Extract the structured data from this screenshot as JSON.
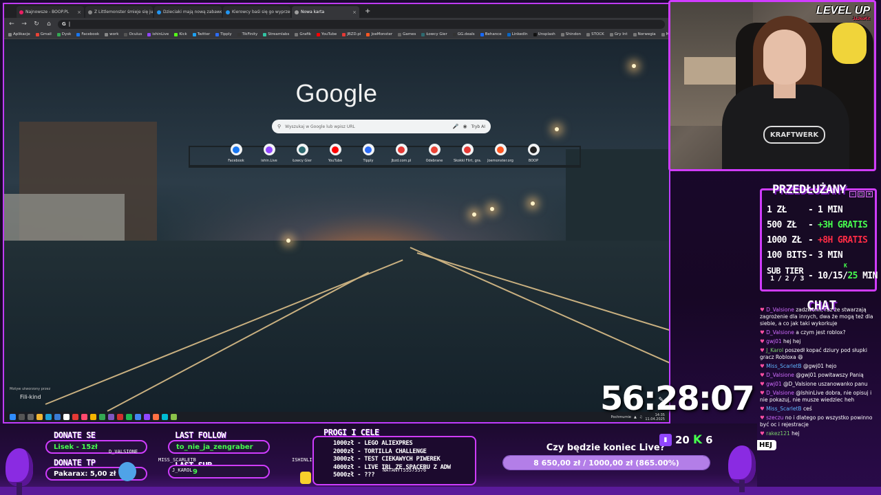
{
  "browser": {
    "tabs": [
      {
        "title": "Najnowsze - BOOP.PL",
        "color": "#e91e63"
      },
      {
        "title": "Z Littlemonster śmieje się już z",
        "color": "#888888"
      },
      {
        "title": "Dzieciaki mają nową zabawę. N",
        "color": "#2196f3"
      },
      {
        "title": "Kierowcy baśi się go wyprzedz",
        "color": "#2196f3"
      },
      {
        "title": "Nowa karta",
        "color": "#9e9e9e"
      }
    ],
    "new_tab_symbol": "+",
    "address_value": "",
    "bookmarks": [
      "Aplikacje",
      "Gmail",
      "Dysk",
      "Facebook",
      "work",
      "Oculus",
      "ishinLive",
      "Kick",
      "Twitter",
      "Tipply",
      "TikFinity",
      "Streamlabs",
      "Grafik",
      "YouTube",
      "JBZD.pl",
      "JoeMonster",
      "Games",
      "Łowcy Gier",
      "GG.deals",
      "Behance",
      "LinkedIn",
      "Unsplash",
      "Shindon",
      "STOCK",
      "Gry Int",
      "Norwegia",
      "Memory 5"
    ],
    "google_logo": "Google",
    "search_placeholder": "Wyszukaj w Google lub wpisz URL",
    "ai_mode": "Tryb AI",
    "shortcuts": [
      {
        "label": "Facebook",
        "color": "#1877f2"
      },
      {
        "label": "ishin.Live",
        "color": "#9146ff"
      },
      {
        "label": "Łowcy Gier",
        "color": "#2d6a70"
      },
      {
        "label": "YouTube",
        "color": "#ff0000"
      },
      {
        "label": "Tipply",
        "color": "#2c6cf6"
      },
      {
        "label": "Jbzd.com.pl",
        "color": "#e53935"
      },
      {
        "label": "Odebrane",
        "color": "#ea4335"
      },
      {
        "label": "Skokki Flirt, gra...",
        "color": "#e53935"
      },
      {
        "label": "Joemonster.org",
        "color": "#ff5722"
      },
      {
        "label": "BOOP",
        "color": "#222222"
      }
    ],
    "credit_small": "Motyw utworzony przez",
    "credit_name": "Fili-kind",
    "tray_label": "Pochmurnie",
    "clock_time": "14:35",
    "clock_date": "11.04.2025"
  },
  "overlay": {
    "levelup": "LEVEL UP",
    "levelup_sub": "JaJkoKit",
    "shirt_text": "KRAFTWERK",
    "panel_title": "PRZEDŁUŻANY",
    "prices": [
      {
        "left": "1 ZŁ",
        "dash": "-",
        "right": "1 MIN",
        "style": ""
      },
      {
        "left": "500 ZŁ",
        "dash": "-",
        "right": "+3H GRATIS",
        "style": "green"
      },
      {
        "left": "1000 ZŁ",
        "dash": "-",
        "right": "+8H GRATIS",
        "style": "red"
      },
      {
        "left": "100 BITS",
        "dash": "-",
        "right": "3 MIN",
        "style": ""
      }
    ],
    "sub_tier_label": "SUB TIER",
    "sub_tier_sub": "1 / 2 / 3",
    "sub_tier_value": "10/15/",
    "sub_tier_value_green": "25",
    "sub_tier_unit": " MIN",
    "sub_tier_k": "K",
    "chat_title": "CHAT",
    "chat_messages": [
      {
        "user": "D_Valsione",
        "text": "zadzwonił, raz że stwarzają zagrożenie dla innych, dwa że mogą też dla siebie, a co jak taki wykorkuje",
        "uclass": "u"
      },
      {
        "user": "D_Valsione",
        "text": "a czym jest roblox?",
        "uclass": "u"
      },
      {
        "user": "gwj01",
        "text": "hej hej",
        "uclass": "u"
      },
      {
        "user": "J_Karol",
        "text": "poszedł kopać dziury pod słupki gracz Robloxa 😄",
        "uclass": "u2"
      },
      {
        "user": "Miss_ScarletB",
        "text": "@gwj01 hejo",
        "uclass": "u3"
      },
      {
        "user": "D_Valsione",
        "text": "@gwj01 powitawszy Panią",
        "uclass": "u"
      },
      {
        "user": "gwj01",
        "text": "@D_Valsione uszanowanko panu",
        "uclass": "u"
      },
      {
        "user": "D_Valsione",
        "text": "@IshinLive dobra, nie opisuj i nie pokazuj, nie musze wiedziec heh",
        "uclass": "u"
      },
      {
        "user": "Miss_ScarletB",
        "text": "ceś",
        "uclass": "u3"
      },
      {
        "user": "szeczu",
        "text": "no i dlatego po wszystko powinno być oc i rejestracje",
        "uclass": "u"
      },
      {
        "user": "rakez121",
        "text": "hej",
        "uclass": "u2"
      }
    ],
    "hej_label": "HEJ",
    "timer": "56:28:07",
    "donate_se_label": "DONATE SE",
    "donate_se_value": "Lisek - 15zł",
    "donate_se_name": "D_VALSIONE",
    "donate_tp_label": "DONATE TP",
    "donate_tp_value": "Pakarax: 5,00 zł",
    "last_follow_label": "LAST FOLLOW",
    "last_follow_value": "to_nie_ja_zengraber",
    "last_sub_label": "LAST SUB",
    "last_sub_name": "MISS_SCARLETB",
    "last_sub_name2": "J_KAROL",
    "last_sub_count": "9",
    "ishin_name": "ISHINLIVE",
    "natan_name": "NATANYT55575576",
    "goals_label": "PROGI I CELE",
    "goals": [
      "1000zł - LEGO ALIEXPRES",
      "2000zł - TORTILLA CHALLENGE",
      "3000zł - TEST CIEKAWYCH PIWEREK",
      "4000zł - LIVE IRL ZE SPACERU Z ADW",
      "5000zł - ???"
    ],
    "poll_question": "Czy będzie koniec Live?",
    "poll_text": "8 650,00 zł / 1000,00 zł (865.00%)",
    "poll_fill": 1.0,
    "viewers": "20",
    "kick_count": "6"
  }
}
